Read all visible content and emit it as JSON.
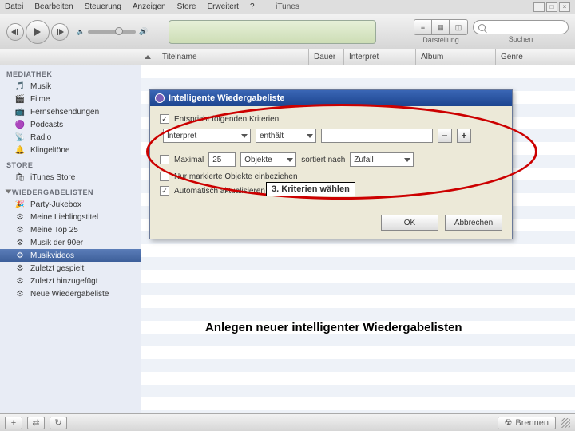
{
  "menu": {
    "items": [
      "Datei",
      "Bearbeiten",
      "Steuerung",
      "Anzeigen",
      "Store",
      "Erweitert",
      "?"
    ],
    "title": "iTunes"
  },
  "toolbar": {
    "view_label": "Darstellung",
    "search_label": "Suchen",
    "search_placeholder": ""
  },
  "columns": {
    "title": "Titelname",
    "duration": "Dauer",
    "artist": "Interpret",
    "album": "Album",
    "genre": "Genre"
  },
  "sidebar": {
    "library_header": "MEDIATHEK",
    "library": [
      {
        "icon": "🎵",
        "label": "Musik"
      },
      {
        "icon": "🎬",
        "label": "Filme"
      },
      {
        "icon": "📺",
        "label": "Fernsehsendungen"
      },
      {
        "icon": "🟣",
        "label": "Podcasts"
      },
      {
        "icon": "📡",
        "label": "Radio"
      },
      {
        "icon": "🔔",
        "label": "Klingeltöne"
      }
    ],
    "store_header": "STORE",
    "store": [
      {
        "icon": "🛍",
        "label": "iTunes Store"
      }
    ],
    "playlists_header": "WIEDERGABELISTEN",
    "playlists": [
      {
        "icon": "🎉",
        "label": "Party-Jukebox"
      },
      {
        "icon": "⚙",
        "label": "Meine Lieblingstitel"
      },
      {
        "icon": "⚙",
        "label": "Meine Top 25"
      },
      {
        "icon": "⚙",
        "label": "Musik der 90er"
      },
      {
        "icon": "⚙",
        "label": "Musikvideos",
        "selected": true
      },
      {
        "icon": "⚙",
        "label": "Zuletzt gespielt"
      },
      {
        "icon": "⚙",
        "label": "Zuletzt hinzugefügt"
      },
      {
        "icon": "⚙",
        "label": "Neue Wiedergabeliste"
      }
    ]
  },
  "dialog": {
    "title": "Intelligente Wiedergabeliste",
    "match_label": "Entspricht folgenden Kriterien:",
    "rule_field": "Interpret",
    "rule_op": "enthält",
    "rule_value": "",
    "limit_cb_label": "Maximal",
    "limit_value": "25",
    "limit_unit": "Objekte",
    "limit_sort_label": "sortiert nach",
    "limit_sort_value": "Zufall",
    "checked_only_label": "Nur markierte Objekte einbeziehen",
    "live_update_label": "Automatisch aktualisieren",
    "ok": "OK",
    "cancel": "Abbrechen"
  },
  "annotation": {
    "step": "3.",
    "text": "Kriterien wählen"
  },
  "caption": "Anlegen neuer intelligenter Wiedergabelisten",
  "statusbar": {
    "burn": "Brennen"
  }
}
